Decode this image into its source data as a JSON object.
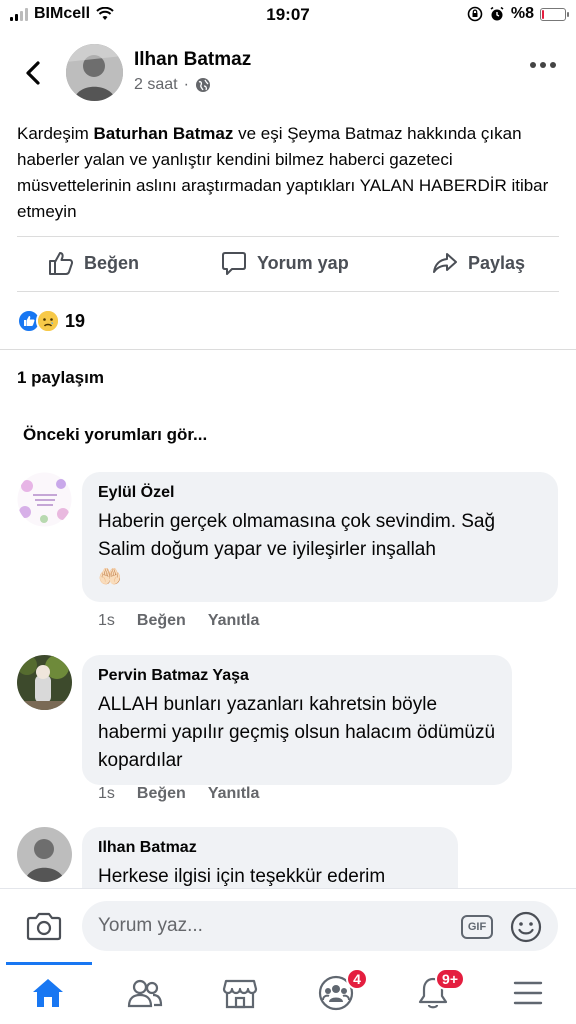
{
  "status_bar": {
    "carrier": "BIMcell",
    "time": "19:07",
    "battery_text": "%8",
    "battery_level": 0.08
  },
  "header": {
    "author_name": "Ilhan Batmaz",
    "post_time": "2 saat",
    "privacy_icon": "globe-icon"
  },
  "post": {
    "text_part1": "Kardeşim ",
    "text_bold": "Baturhan Batmaz",
    "text_part2": " ve eşi Şeyma Batmaz hakkında çıkan haberler yalan ve yanlıştır kendini bilmez haberci gazeteci müsvettelerinin aslını araştırmadan yaptıkları YALAN HABERDİR itibar etmeyin"
  },
  "actions": {
    "like": "Beğen",
    "comment": "Yorum yap",
    "share": "Paylaş"
  },
  "reactions": {
    "count": "19",
    "types": [
      "like-icon",
      "sad-icon"
    ]
  },
  "share_count": "1 paylaşım",
  "previous_comments": "Önceki yorumları gör...",
  "comments": [
    {
      "name": "Eylül Özel",
      "text": "Haberin gerçek olmamasına çok sevindim. Sağ Salim doğum yapar ve iyileşirler inşallah",
      "emoji": "🤲🏻",
      "time": "1s",
      "like": "Beğen",
      "reply": "Yanıtla"
    },
    {
      "name": "Pervin Batmaz Yaşa",
      "text": "ALLAH bunları yazanları kahretsin böyle habermi yapılır geçmiş olsun halacım ödümüzü kopardılar",
      "time": "1s",
      "like": "Beğen",
      "reply": "Yanıtla"
    },
    {
      "name": "Ilhan Batmaz",
      "text": "Herkese ilgisi için teşekkür ederim"
    }
  ],
  "composer": {
    "placeholder": "Yorum yaz...",
    "gif_label": "GIF"
  },
  "tab_bar": {
    "groups_badge": "4",
    "notifications_badge": "9+",
    "active_color": "#1877f2"
  }
}
